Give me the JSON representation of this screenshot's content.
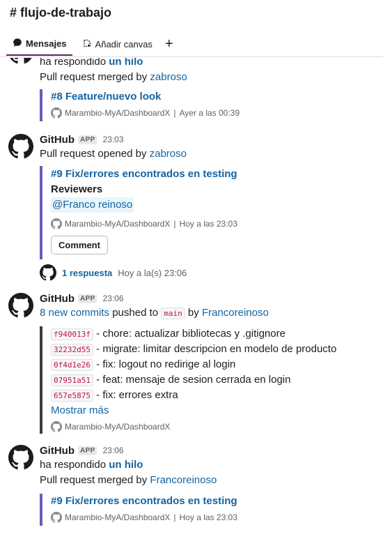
{
  "channel": {
    "title": "# flujo-de-trabajo"
  },
  "tabs": [
    {
      "label": "Mensajes"
    },
    {
      "label": "Añadir canvas"
    }
  ],
  "add_tab_symbol": "+",
  "messages": {
    "m0": {
      "replied_prefix": "ha respondido ",
      "replied_link": "un hilo",
      "text_prefix": "Pull request merged by ",
      "user": "zabroso",
      "attachment": {
        "title": "#8 Feature/nuevo look",
        "repo": "Marambio-MyA/DashboardX",
        "sep": "|",
        "time": "Ayer a las 00:39"
      }
    },
    "m1": {
      "sender": "GitHub",
      "badge": "APP",
      "time": "23:03",
      "text_prefix": "Pull request opened by ",
      "user": "zabroso",
      "attachment": {
        "title": "#9 Fix/errores encontrados en testing",
        "reviewers_label": "Reviewers",
        "reviewer": "@Franco reinoso",
        "repo": "Marambio-MyA/DashboardX",
        "sep": "|",
        "time": "Hoy a las 23:03",
        "button": "Comment"
      },
      "thread": {
        "count": "1 respuesta",
        "time": "Hoy a la(s) 23:06"
      }
    },
    "m2": {
      "sender": "GitHub",
      "badge": "APP",
      "time": "23:06",
      "commits_link": "8 new commits",
      "pushed_text": " pushed to ",
      "branch": "main",
      "by_text": " by ",
      "user": "Francoreinoso",
      "commits": [
        {
          "hash": "f940013f",
          "message": " - chore: actualizar bibliotecas y .gitignore"
        },
        {
          "hash": "32232d55",
          "message": " - migrate: limitar descripcion en modelo de producto"
        },
        {
          "hash": "0f4d1e26",
          "message": " - fix: logout no redirige al login"
        },
        {
          "hash": "07951a51",
          "message": " - feat: mensaje de sesion cerrada en login"
        },
        {
          "hash": "657e5875",
          "message": " - fix: errores extra"
        }
      ],
      "show_more": "Mostrar más",
      "repo": "Marambio-MyA/DashboardX"
    },
    "m3": {
      "sender": "GitHub",
      "badge": "APP",
      "time": "23:06",
      "replied_prefix": "ha respondido ",
      "replied_link": "un hilo",
      "text_prefix": "Pull request merged by ",
      "user": "Francoreinoso",
      "attachment": {
        "title": "#9 Fix/errores encontrados en testing",
        "repo": "Marambio-MyA/DashboardX",
        "sep": "|",
        "time": "Hoy a las 23:03"
      }
    }
  },
  "colors": {
    "link": "#1264a3",
    "pr_accent": "#6f5bb8",
    "push_accent": "#3c3c3c",
    "tab_underline": "#611f69"
  },
  "icons": [
    "chat-bubble-icon",
    "canvas-icon",
    "plus-icon",
    "github-icon"
  ]
}
